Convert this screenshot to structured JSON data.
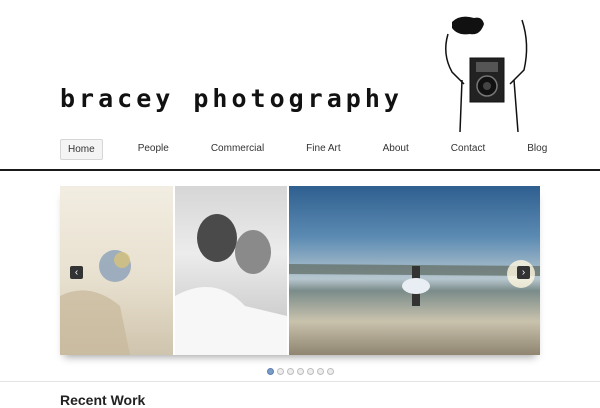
{
  "site": {
    "title": "bracey photography"
  },
  "nav": {
    "items": [
      "Home",
      "People",
      "Commercial",
      "Fine Art",
      "About",
      "Contact",
      "Blog"
    ]
  },
  "slider": {
    "prev_icon": "chevron-left-icon",
    "next_icon": "chevron-right-icon",
    "prev_glyph": "‹",
    "next_glyph": "›",
    "dots_count": 7,
    "active_dot": 1
  },
  "section": {
    "title": "Recent Work"
  },
  "colors": {
    "text": "#222222",
    "rule": "#1a1a1a",
    "dot_active": "#7a9cc7"
  }
}
